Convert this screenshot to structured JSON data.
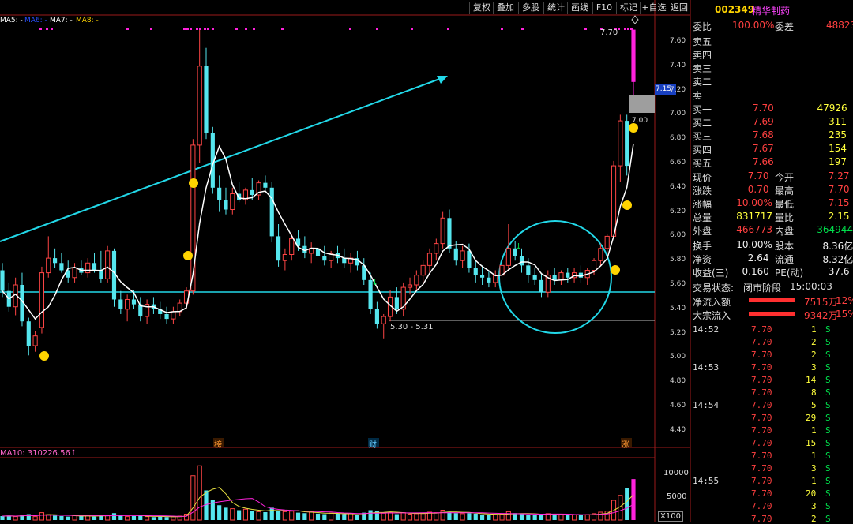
{
  "toolbar": {
    "buttons": [
      "复权",
      "叠加",
      "多股",
      "统计",
      "画线",
      "F10",
      "标记",
      "+自选",
      "返回"
    ]
  },
  "ma_labels": {
    "ma5": "MA5: -",
    "ma6": "MA6: -",
    "ma7": "MA7: -",
    "ma8": "MA8: -"
  },
  "price_axis": {
    "ticks": [
      "7.60",
      "7.40",
      "7.20",
      "7.00",
      "6.80",
      "6.60",
      "6.40",
      "6.20",
      "6.00",
      "5.80",
      "5.60",
      "5.40",
      "5.20",
      "5.00",
      "4.80",
      "4.60",
      "4.40"
    ],
    "current_price_tag": "7.15",
    "high_label": "7.70",
    "level_label": "7.00",
    "low_range_label": "5.30 - 5.31"
  },
  "volume_panel": {
    "label": "MA10: 310226.56↑",
    "ticks": [
      "10000",
      "5000"
    ],
    "unit": "X100"
  },
  "event_markers": [
    "榜",
    "财",
    "涨"
  ],
  "stock": {
    "code": "002349",
    "name": "精华制药"
  },
  "order_book": {
    "weibi_label": "委比",
    "weibi_value": "100.00%",
    "weicha_label": "委差",
    "weicha_value": "48823",
    "asks": [
      {
        "label": "卖五"
      },
      {
        "label": "卖四"
      },
      {
        "label": "卖三"
      },
      {
        "label": "卖二"
      },
      {
        "label": "卖一"
      }
    ],
    "bids": [
      {
        "label": "买一",
        "price": "7.70",
        "vol": "47926"
      },
      {
        "label": "买二",
        "price": "7.69",
        "vol": "311"
      },
      {
        "label": "买三",
        "price": "7.68",
        "vol": "235"
      },
      {
        "label": "买四",
        "price": "7.67",
        "vol": "154"
      },
      {
        "label": "买五",
        "price": "7.66",
        "vol": "197"
      }
    ]
  },
  "quote": [
    {
      "l1": "现价",
      "v1": "7.70",
      "l2": "今开",
      "v2": "7.27"
    },
    {
      "l1": "涨跌",
      "v1": "0.70",
      "l2": "最高",
      "v2": "7.70"
    },
    {
      "l1": "涨幅",
      "v1": "10.00%",
      "l2": "最低",
      "v2": "7.15"
    },
    {
      "l1": "总量",
      "v1": "831717",
      "l2": "量比",
      "v2": "2.15"
    },
    {
      "l1": "外盘",
      "v1": "466773",
      "l2": "内盘",
      "v2": "364944"
    }
  ],
  "fundamentals": [
    {
      "l1": "换手",
      "v1": "10.00%",
      "l2": "股本",
      "v2": "8.36亿"
    },
    {
      "l1": "净资",
      "v1": "2.64",
      "l2": "流通",
      "v2": "8.32亿"
    },
    {
      "l1": "收益(三)",
      "v1": "0.160",
      "l2": "PE(动)",
      "v2": "37.6"
    }
  ],
  "trade_status": {
    "label": "交易状态:",
    "value": "闭市阶段",
    "time": "15:00:03"
  },
  "flows": [
    {
      "label": "净流入额",
      "value": "7515万",
      "pct": "12%"
    },
    {
      "label": "大宗流入",
      "value": "9342万",
      "pct": "15%"
    }
  ],
  "ticks": [
    {
      "time": "14:52",
      "price": "7.70",
      "vol": "1",
      "side": "S"
    },
    {
      "time": "",
      "price": "7.70",
      "vol": "2",
      "side": "S"
    },
    {
      "time": "",
      "price": "7.70",
      "vol": "2",
      "side": "S"
    },
    {
      "time": "14:53",
      "price": "7.70",
      "vol": "3",
      "side": "S"
    },
    {
      "time": "",
      "price": "7.70",
      "vol": "14",
      "side": "S"
    },
    {
      "time": "",
      "price": "7.70",
      "vol": "8",
      "side": "S"
    },
    {
      "time": "14:54",
      "price": "7.70",
      "vol": "5",
      "side": "S"
    },
    {
      "time": "",
      "price": "7.70",
      "vol": "29",
      "side": "S"
    },
    {
      "time": "",
      "price": "7.70",
      "vol": "1",
      "side": "S"
    },
    {
      "time": "",
      "price": "7.70",
      "vol": "15",
      "side": "S"
    },
    {
      "time": "",
      "price": "7.70",
      "vol": "1",
      "side": "S"
    },
    {
      "time": "",
      "price": "7.70",
      "vol": "3",
      "side": "S"
    },
    {
      "time": "14:55",
      "price": "7.70",
      "vol": "1",
      "side": "S"
    },
    {
      "time": "",
      "price": "7.70",
      "vol": "20",
      "side": "S"
    },
    {
      "time": "",
      "price": "7.70",
      "vol": "3",
      "side": "S"
    },
    {
      "time": "",
      "price": "7.70",
      "vol": "2",
      "side": "S"
    }
  ],
  "colors": {
    "up": "#ff4545",
    "down": "#55e6ee",
    "limit_up": "#ff22dd",
    "ma_line": "#ffffff",
    "annotation": "#22d8e8",
    "panel_border": "#9b1a1a"
  },
  "chart_data": {
    "type": "candlestick",
    "y_range": [
      4.3,
      7.75
    ],
    "volume_range": [
      0,
      12000
    ],
    "candles": [
      [
        5.72,
        5.78,
        5.5,
        5.55
      ],
      [
        5.55,
        5.62,
        5.38,
        5.42
      ],
      [
        5.42,
        5.66,
        5.35,
        5.6
      ],
      [
        5.6,
        5.7,
        5.26,
        5.3
      ],
      [
        5.3,
        5.33,
        5.02,
        5.1
      ],
      [
        5.1,
        5.22,
        5.05,
        5.18
      ],
      [
        5.25,
        5.75,
        5.2,
        5.7
      ],
      [
        5.7,
        6.0,
        5.66,
        5.82
      ],
      [
        5.82,
        5.9,
        5.74,
        5.78
      ],
      [
        5.78,
        5.86,
        5.7,
        5.72
      ],
      [
        5.72,
        5.8,
        5.62,
        5.66
      ],
      [
        5.66,
        5.78,
        5.62,
        5.74
      ],
      [
        5.74,
        5.8,
        5.68,
        5.7
      ],
      [
        5.7,
        5.82,
        5.66,
        5.78
      ],
      [
        5.78,
        5.86,
        5.7,
        5.72
      ],
      [
        5.72,
        5.88,
        5.62,
        5.65
      ],
      [
        5.65,
        5.92,
        5.62,
        5.88
      ],
      [
        5.88,
        5.9,
        5.42,
        5.48
      ],
      [
        5.48,
        5.55,
        5.36,
        5.4
      ],
      [
        5.4,
        5.52,
        5.3,
        5.48
      ],
      [
        5.48,
        5.56,
        5.4,
        5.44
      ],
      [
        5.44,
        5.5,
        5.3,
        5.34
      ],
      [
        5.34,
        5.48,
        5.28,
        5.44
      ],
      [
        5.44,
        5.5,
        5.36,
        5.4
      ],
      [
        5.4,
        5.46,
        5.32,
        5.36
      ],
      [
        5.36,
        5.42,
        5.28,
        5.32
      ],
      [
        5.32,
        5.42,
        5.28,
        5.38
      ],
      [
        5.38,
        5.48,
        5.34,
        5.45
      ],
      [
        5.45,
        5.58,
        5.4,
        5.55
      ],
      [
        5.55,
        6.8,
        5.52,
        6.75
      ],
      [
        6.75,
        7.7,
        6.6,
        7.4
      ],
      [
        7.4,
        7.55,
        6.8,
        6.85
      ],
      [
        6.85,
        6.9,
        6.35,
        6.4
      ],
      [
        6.4,
        6.5,
        6.2,
        6.3
      ],
      [
        6.3,
        6.4,
        6.18,
        6.22
      ],
      [
        6.22,
        6.4,
        6.18,
        6.35
      ],
      [
        6.35,
        6.45,
        6.28,
        6.3
      ],
      [
        6.3,
        6.4,
        6.26,
        6.38
      ],
      [
        6.38,
        6.48,
        6.3,
        6.34
      ],
      [
        6.34,
        6.46,
        6.3,
        6.44
      ],
      [
        6.44,
        6.5,
        6.38,
        6.4
      ],
      [
        6.4,
        6.45,
        5.95,
        6.0
      ],
      [
        6.0,
        6.1,
        5.75,
        5.8
      ],
      [
        5.8,
        5.9,
        5.72,
        5.85
      ],
      [
        5.85,
        6.02,
        5.8,
        5.98
      ],
      [
        5.98,
        6.05,
        5.88,
        5.92
      ],
      [
        5.92,
        6.0,
        5.82,
        5.86
      ],
      [
        5.86,
        5.95,
        5.78,
        5.9
      ],
      [
        5.9,
        5.96,
        5.8,
        5.84
      ],
      [
        5.84,
        5.92,
        5.76,
        5.8
      ],
      [
        5.8,
        5.88,
        5.74,
        5.86
      ],
      [
        5.86,
        5.92,
        5.78,
        5.82
      ],
      [
        5.82,
        5.9,
        5.74,
        5.78
      ],
      [
        5.78,
        5.86,
        5.7,
        5.82
      ],
      [
        5.82,
        5.88,
        5.72,
        5.76
      ],
      [
        5.76,
        5.82,
        5.6,
        5.64
      ],
      [
        5.64,
        5.7,
        5.36,
        5.4
      ],
      [
        5.4,
        5.46,
        5.24,
        5.28
      ],
      [
        5.28,
        5.36,
        5.16,
        5.34
      ],
      [
        5.34,
        5.56,
        5.3,
        5.5
      ],
      [
        5.5,
        5.58,
        5.36,
        5.4
      ],
      [
        5.4,
        5.62,
        5.34,
        5.58
      ],
      [
        5.58,
        5.66,
        5.52,
        5.6
      ],
      [
        5.6,
        5.72,
        5.56,
        5.68
      ],
      [
        5.68,
        5.8,
        5.62,
        5.76
      ],
      [
        5.76,
        5.9,
        5.7,
        5.86
      ],
      [
        5.86,
        5.98,
        5.8,
        5.94
      ],
      [
        5.94,
        6.2,
        5.9,
        6.15
      ],
      [
        6.15,
        6.22,
        5.86,
        5.9
      ],
      [
        5.9,
        5.96,
        5.76,
        5.8
      ],
      [
        5.8,
        5.92,
        5.74,
        5.88
      ],
      [
        5.88,
        5.94,
        5.7,
        5.74
      ],
      [
        5.74,
        5.8,
        5.62,
        5.68
      ],
      [
        5.68,
        5.76,
        5.6,
        5.66
      ],
      [
        5.66,
        5.72,
        5.58,
        5.62
      ],
      [
        5.62,
        5.72,
        5.58,
        5.68
      ],
      [
        5.68,
        5.8,
        5.64,
        5.76
      ],
      [
        5.76,
        6.1,
        5.72,
        5.9
      ],
      [
        5.9,
        5.96,
        5.8,
        5.84
      ],
      [
        5.84,
        5.9,
        5.7,
        5.76
      ],
      [
        5.76,
        5.82,
        5.62,
        5.68
      ],
      [
        5.68,
        5.74,
        5.6,
        5.64
      ],
      [
        5.64,
        5.7,
        5.5,
        5.54
      ],
      [
        5.54,
        5.72,
        5.5,
        5.68
      ],
      [
        5.68,
        5.74,
        5.6,
        5.64
      ],
      [
        5.64,
        5.72,
        5.6,
        5.7
      ],
      [
        5.7,
        5.74,
        5.62,
        5.66
      ],
      [
        5.66,
        5.74,
        5.62,
        5.7
      ],
      [
        5.7,
        5.76,
        5.62,
        5.66
      ],
      [
        5.66,
        5.74,
        5.6,
        5.72
      ],
      [
        5.72,
        5.82,
        5.68,
        5.8
      ],
      [
        5.8,
        5.94,
        5.76,
        5.9
      ],
      [
        5.9,
        6.02,
        5.86,
        6.0
      ],
      [
        6.0,
        6.62,
        5.98,
        6.58
      ],
      [
        6.58,
        7.0,
        6.45,
        6.95
      ],
      [
        6.95,
        7.0,
        6.5,
        6.58
      ],
      [
        7.27,
        7.7,
        7.15,
        7.7
      ]
    ],
    "volumes": [
      800,
      900,
      700,
      1000,
      1200,
      700,
      1500,
      1100,
      900,
      800,
      700,
      900,
      800,
      900,
      700,
      900,
      1000,
      1400,
      900,
      700,
      800,
      900,
      700,
      600,
      700,
      600,
      700,
      800,
      1200,
      9000,
      11000,
      6000,
      4000,
      3000,
      2500,
      2300,
      2000,
      2200,
      1800,
      1700,
      1600,
      2500,
      2000,
      1700,
      1800,
      1500,
      1400,
      1600,
      1300,
      1200,
      1400,
      1300,
      1200,
      1300,
      1100,
      1500,
      2000,
      1800,
      1400,
      1600,
      1200,
      1500,
      1200,
      1300,
      1400,
      1600,
      1500,
      2000,
      1700,
      1400,
      1300,
      1400,
      1300,
      1100,
      1000,
      1100,
      1200,
      1700,
      1400,
      1200,
      1100,
      1000,
      1200,
      1300,
      1000,
      1100,
      1000,
      1100,
      1000,
      1100,
      1300,
      1600,
      1800,
      4000,
      5000,
      6500,
      8300
    ]
  }
}
